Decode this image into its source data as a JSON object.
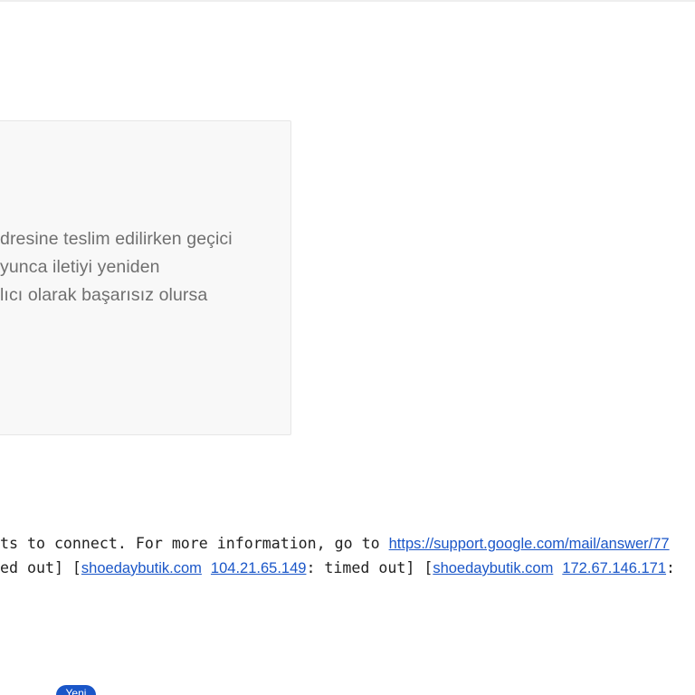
{
  "notice": {
    "line1": "dresine teslim edilirken geçici",
    "line2": "yunca iletiyi yeniden",
    "line3": "lıcı olarak başarısız olursa"
  },
  "error_log": {
    "line1_text": "ts to connect. For more information, go to ",
    "line1_link": "https://support.google.com/mail/answer/77",
    "line2_prefix": "ed out] [",
    "host1": "shoedaybutik.com",
    "ip1": "104.21.65.149",
    "line2_mid": ": timed out] [",
    "host2": "shoedaybutik.com",
    "ip2": "172.67.146.171",
    "line2_suffix": ":"
  },
  "badge": {
    "label": "Yeni"
  },
  "colors": {
    "link": "#1a56c8",
    "badge_bg": "#1a56c8",
    "card_bg": "#f8f8f8",
    "notice_text": "#6f6f6f"
  }
}
